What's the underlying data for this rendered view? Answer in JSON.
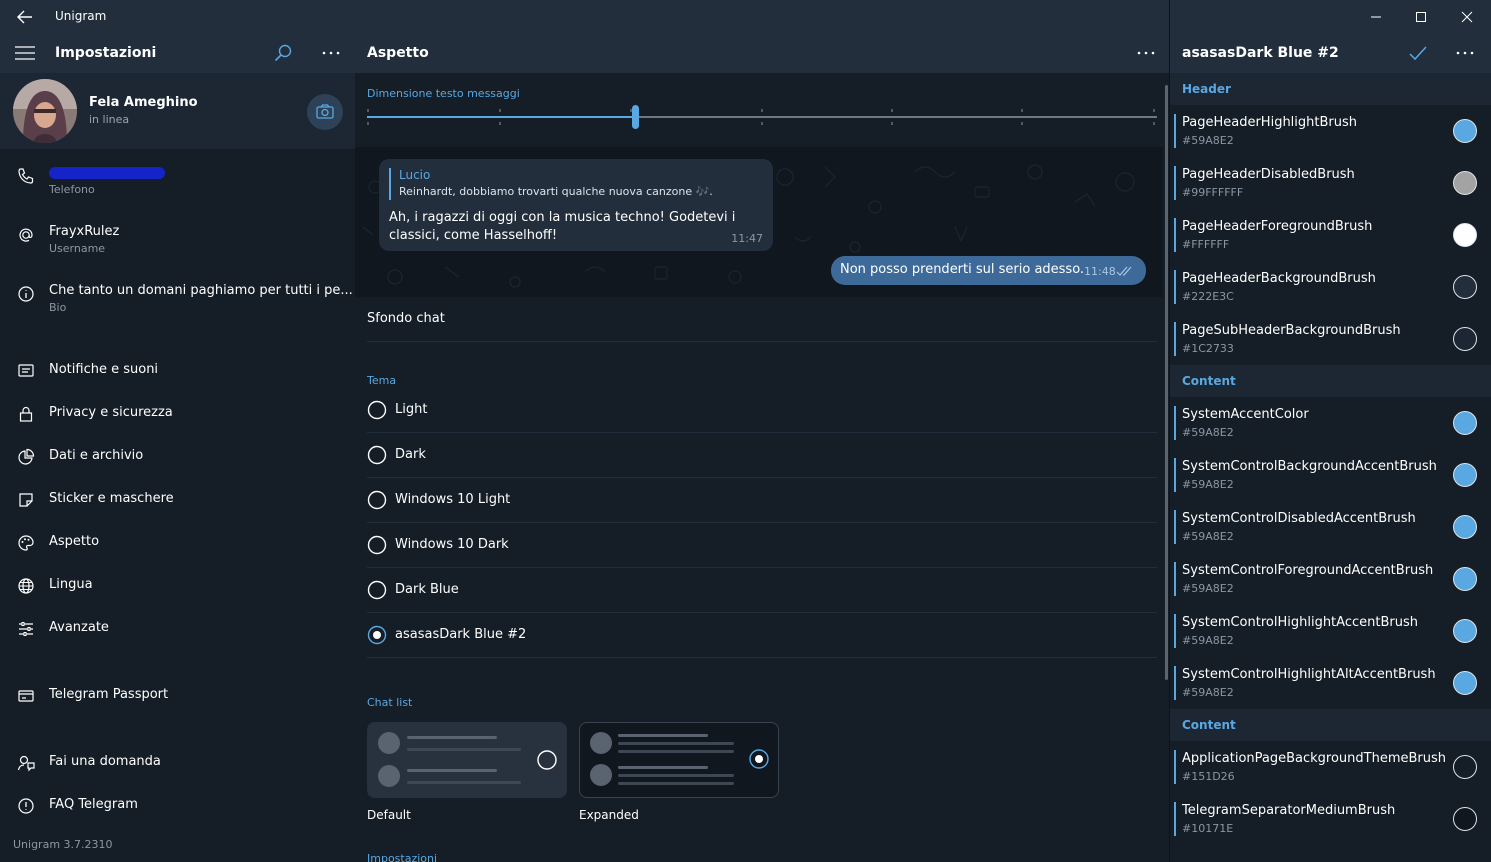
{
  "app": {
    "title": "Unigram",
    "version": "Unigram 3.7.2310"
  },
  "left": {
    "header_title": "Impostazioni",
    "profile": {
      "name": "Fela Ameghino",
      "status": "in linea"
    },
    "info": [
      {
        "value": "",
        "label": "Telefono",
        "icon": "phone-icon"
      },
      {
        "value": "FrayxRulez",
        "label": "Username",
        "icon": "at-icon"
      },
      {
        "value": "Che tanto un domani paghiamo per tutti i pe...",
        "label": "Bio",
        "icon": "info-icon"
      }
    ],
    "menu": [
      {
        "label": "Notifiche e suoni",
        "icon": "notifications-icon"
      },
      {
        "label": "Privacy e sicurezza",
        "icon": "lock-icon"
      },
      {
        "label": "Dati e archivio",
        "icon": "pie-chart-icon"
      },
      {
        "label": "Sticker e maschere",
        "icon": "sticker-icon"
      },
      {
        "label": "Aspetto",
        "icon": "palette-icon"
      },
      {
        "label": "Lingua",
        "icon": "globe-icon"
      },
      {
        "label": "Avanzate",
        "icon": "sliders-icon"
      },
      {
        "label": "Telegram Passport",
        "icon": "passport-icon"
      },
      {
        "label": "Fai una domanda",
        "icon": "ask-icon"
      },
      {
        "label": "FAQ Telegram",
        "icon": "faq-icon"
      }
    ]
  },
  "mid": {
    "title": "Aspetto",
    "text_size_label": "Dimensione testo messaggi",
    "text_size_level": 0.34,
    "preview": {
      "reply_name": "Lucio",
      "reply_text": "Reinhardt, dobbiamo trovarti qualche nuova canzone 🎶.",
      "incoming_text": "Ah, i ragazzi di oggi con la musica techno! Godetevi i classici, come Hasselhoff!",
      "incoming_time": "11:47",
      "outgoing_text": "Non posso prenderti sul serio adesso.",
      "outgoing_time": "11:48"
    },
    "wallpaper_label": "Sfondo chat",
    "theme_label": "Tema",
    "themes": [
      "Light",
      "Dark",
      "Windows 10 Light",
      "Windows 10 Dark",
      "Dark Blue",
      "asasasDark Blue #2"
    ],
    "selected_theme": "asasasDark Blue #2",
    "chat_list_label": "Chat list",
    "chat_list_options": [
      "Default",
      "Expanded"
    ],
    "selected_chat_list": "Expanded",
    "next_section_label": "Impostazioni"
  },
  "right": {
    "title": "asasasDark Blue #2",
    "groups": [
      {
        "name": "Header",
        "brushes": [
          {
            "name": "PageHeaderHighlightBrush",
            "hex": "#59A8E2",
            "color": "#59A8E2"
          },
          {
            "name": "PageHeaderDisabledBrush",
            "hex": "#99FFFFFF",
            "color": "#A3A3A3"
          },
          {
            "name": "PageHeaderForegroundBrush",
            "hex": "#FFFFFF",
            "color": "#FFFFFF"
          },
          {
            "name": "PageHeaderBackgroundBrush",
            "hex": "#222E3C",
            "color": "#222E3C"
          },
          {
            "name": "PageSubHeaderBackgroundBrush",
            "hex": "#1C2733",
            "color": "#1C2733"
          }
        ]
      },
      {
        "name": "Content",
        "brushes": [
          {
            "name": "SystemAccentColor",
            "hex": "#59A8E2",
            "color": "#59A8E2"
          },
          {
            "name": "SystemControlBackgroundAccentBrush",
            "hex": "#59A8E2",
            "color": "#59A8E2"
          },
          {
            "name": "SystemControlDisabledAccentBrush",
            "hex": "#59A8E2",
            "color": "#59A8E2"
          },
          {
            "name": "SystemControlForegroundAccentBrush",
            "hex": "#59A8E2",
            "color": "#59A8E2"
          },
          {
            "name": "SystemControlHighlightAccentBrush",
            "hex": "#59A8E2",
            "color": "#59A8E2"
          },
          {
            "name": "SystemControlHighlightAltAccentBrush",
            "hex": "#59A8E2",
            "color": "#59A8E2"
          }
        ]
      },
      {
        "name": "Content",
        "brushes": [
          {
            "name": "ApplicationPageBackgroundThemeBrush",
            "hex": "#151D26",
            "color": "#151D26"
          },
          {
            "name": "TelegramSeparatorMediumBrush",
            "hex": "#10171E",
            "color": "#10171E"
          }
        ]
      }
    ]
  },
  "colors": {
    "accent": "#59A8E2",
    "header": "#222E3C",
    "subheader": "#1C2733",
    "background": "#151D26"
  }
}
